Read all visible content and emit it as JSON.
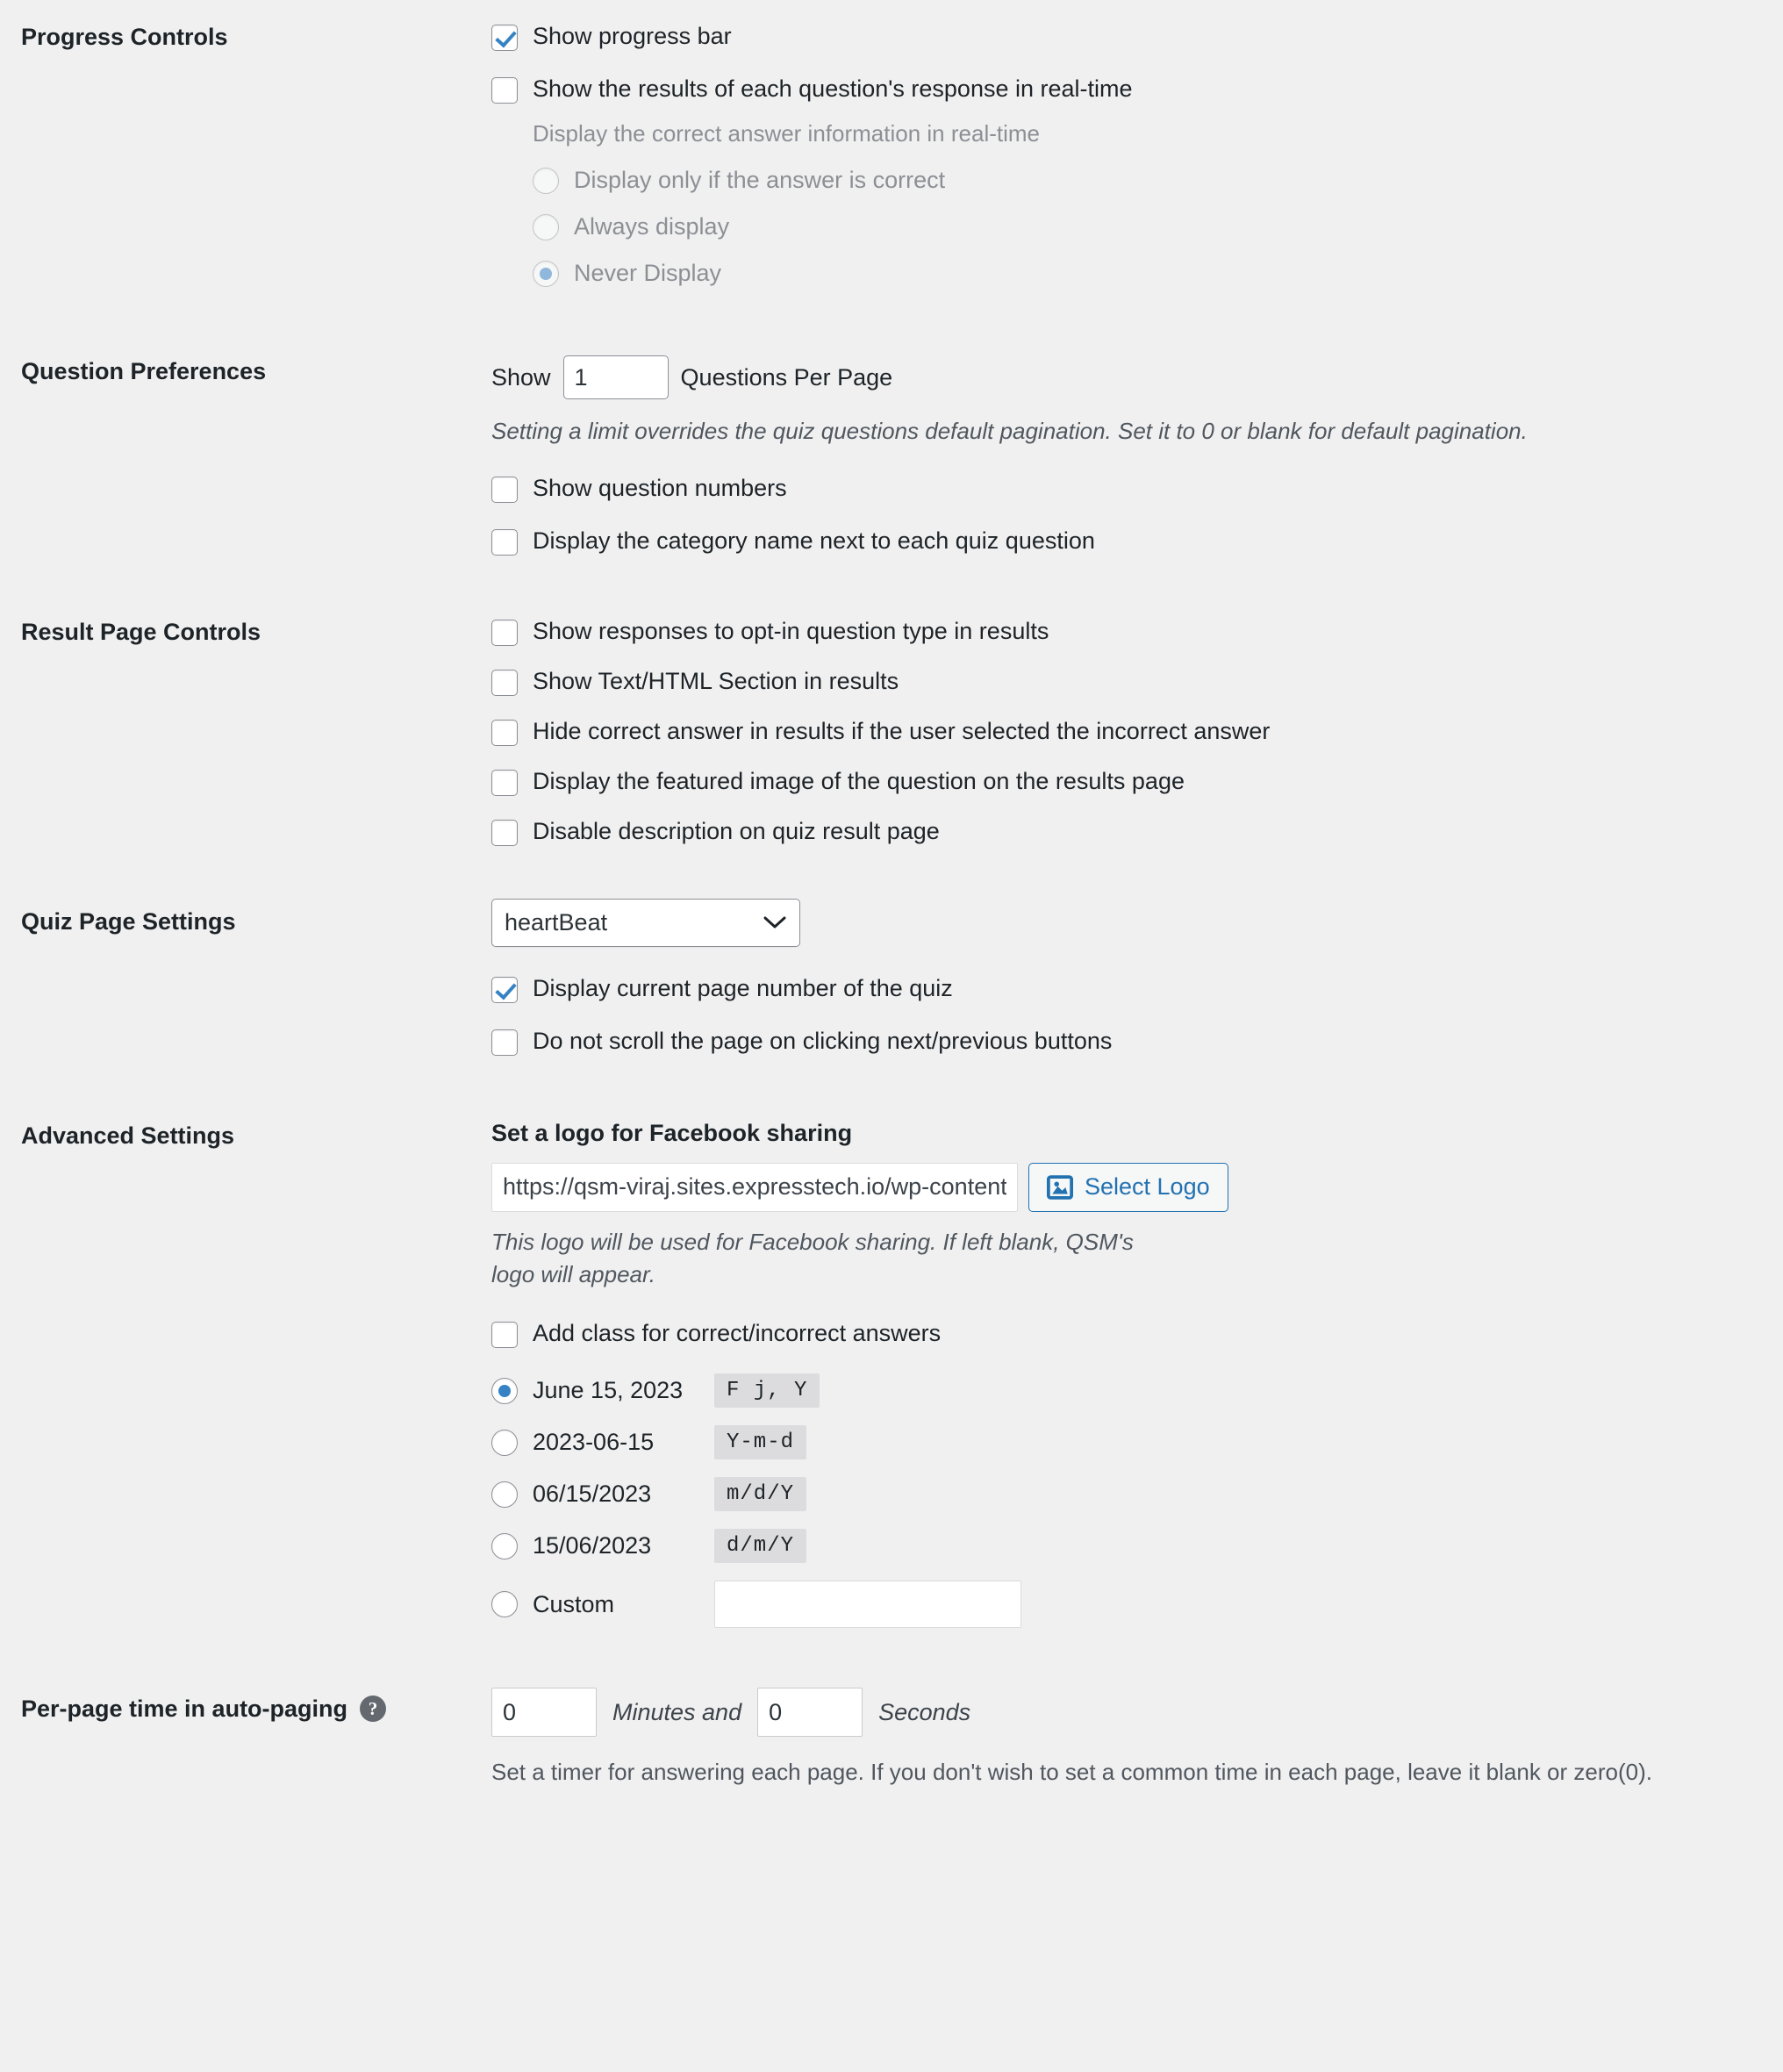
{
  "progress_controls": {
    "label": "Progress Controls",
    "show_progress_bar": "Show progress bar",
    "show_realtime_results": "Show the results of each question's response in real-time",
    "realtime_note": "Display the correct answer information in real-time",
    "radios": [
      {
        "label": "Display only if the answer is correct",
        "selected": false
      },
      {
        "label": "Always display",
        "selected": false
      },
      {
        "label": "Never Display",
        "selected": true
      }
    ]
  },
  "question_preferences": {
    "label": "Question Preferences",
    "show_prefix": "Show",
    "questions_per_page_value": "1",
    "show_suffix": "Questions Per Page",
    "pagination_note": "Setting a limit overrides the quiz questions default pagination. Set it to 0 or blank for default pagination.",
    "checkboxes": [
      {
        "label": "Show question numbers",
        "checked": false
      },
      {
        "label": "Display the category name next to each quiz question",
        "checked": false
      }
    ]
  },
  "result_page_controls": {
    "label": "Result Page Controls",
    "checkboxes": [
      {
        "label": "Show responses to opt-in question type in results",
        "checked": false
      },
      {
        "label": "Show Text/HTML Section in results",
        "checked": false
      },
      {
        "label": "Hide correct answer in results if the user selected the incorrect answer",
        "checked": false
      },
      {
        "label": "Display the featured image of the question on the results page",
        "checked": false
      },
      {
        "label": "Disable description on quiz result page",
        "checked": false
      }
    ]
  },
  "quiz_page_settings": {
    "label": "Quiz Page Settings",
    "animation_selected": "heartBeat",
    "animation_options": [
      "heartBeat"
    ],
    "checkboxes": [
      {
        "label": "Display current page number of the quiz",
        "checked": true
      },
      {
        "label": "Do not scroll the page on clicking next/previous buttons",
        "checked": false
      }
    ]
  },
  "advanced_settings": {
    "label": "Advanced Settings",
    "logo_title": "Set a logo for Facebook sharing",
    "logo_url_value": "https://qsm-viraj.sites.expresstech.io/wp-content/uploads/",
    "select_logo_button": "Select Logo",
    "logo_note": "This logo will be used for Facebook sharing. If left blank, QSM's logo will appear.",
    "add_class_checkbox": {
      "label": "Add class for correct/incorrect answers",
      "checked": false
    },
    "date_formats": [
      {
        "example": "June 15, 2023",
        "code": "F j, Y",
        "selected": true
      },
      {
        "example": "2023-06-15",
        "code": "Y-m-d",
        "selected": false
      },
      {
        "example": "06/15/2023",
        "code": "m/d/Y",
        "selected": false
      },
      {
        "example": "15/06/2023",
        "code": "d/m/Y",
        "selected": false
      }
    ],
    "custom_format": {
      "label": "Custom",
      "value": "",
      "selected": false
    }
  },
  "per_page_time": {
    "label": "Per-page time in auto-paging",
    "help_icon": "question-mark-icon",
    "minutes_value": "0",
    "minutes_label": "Minutes and",
    "seconds_value": "0",
    "seconds_label": "Seconds",
    "note": "Set a timer for answering each page. If you don't wish to set a common time in each page, leave it blank or zero(0)."
  },
  "colors": {
    "accent_blue": "#3582c4",
    "link_blue": "#2271b1",
    "background": "#f0f0f1",
    "text": "#1d2327",
    "muted": "#8c8f94"
  }
}
